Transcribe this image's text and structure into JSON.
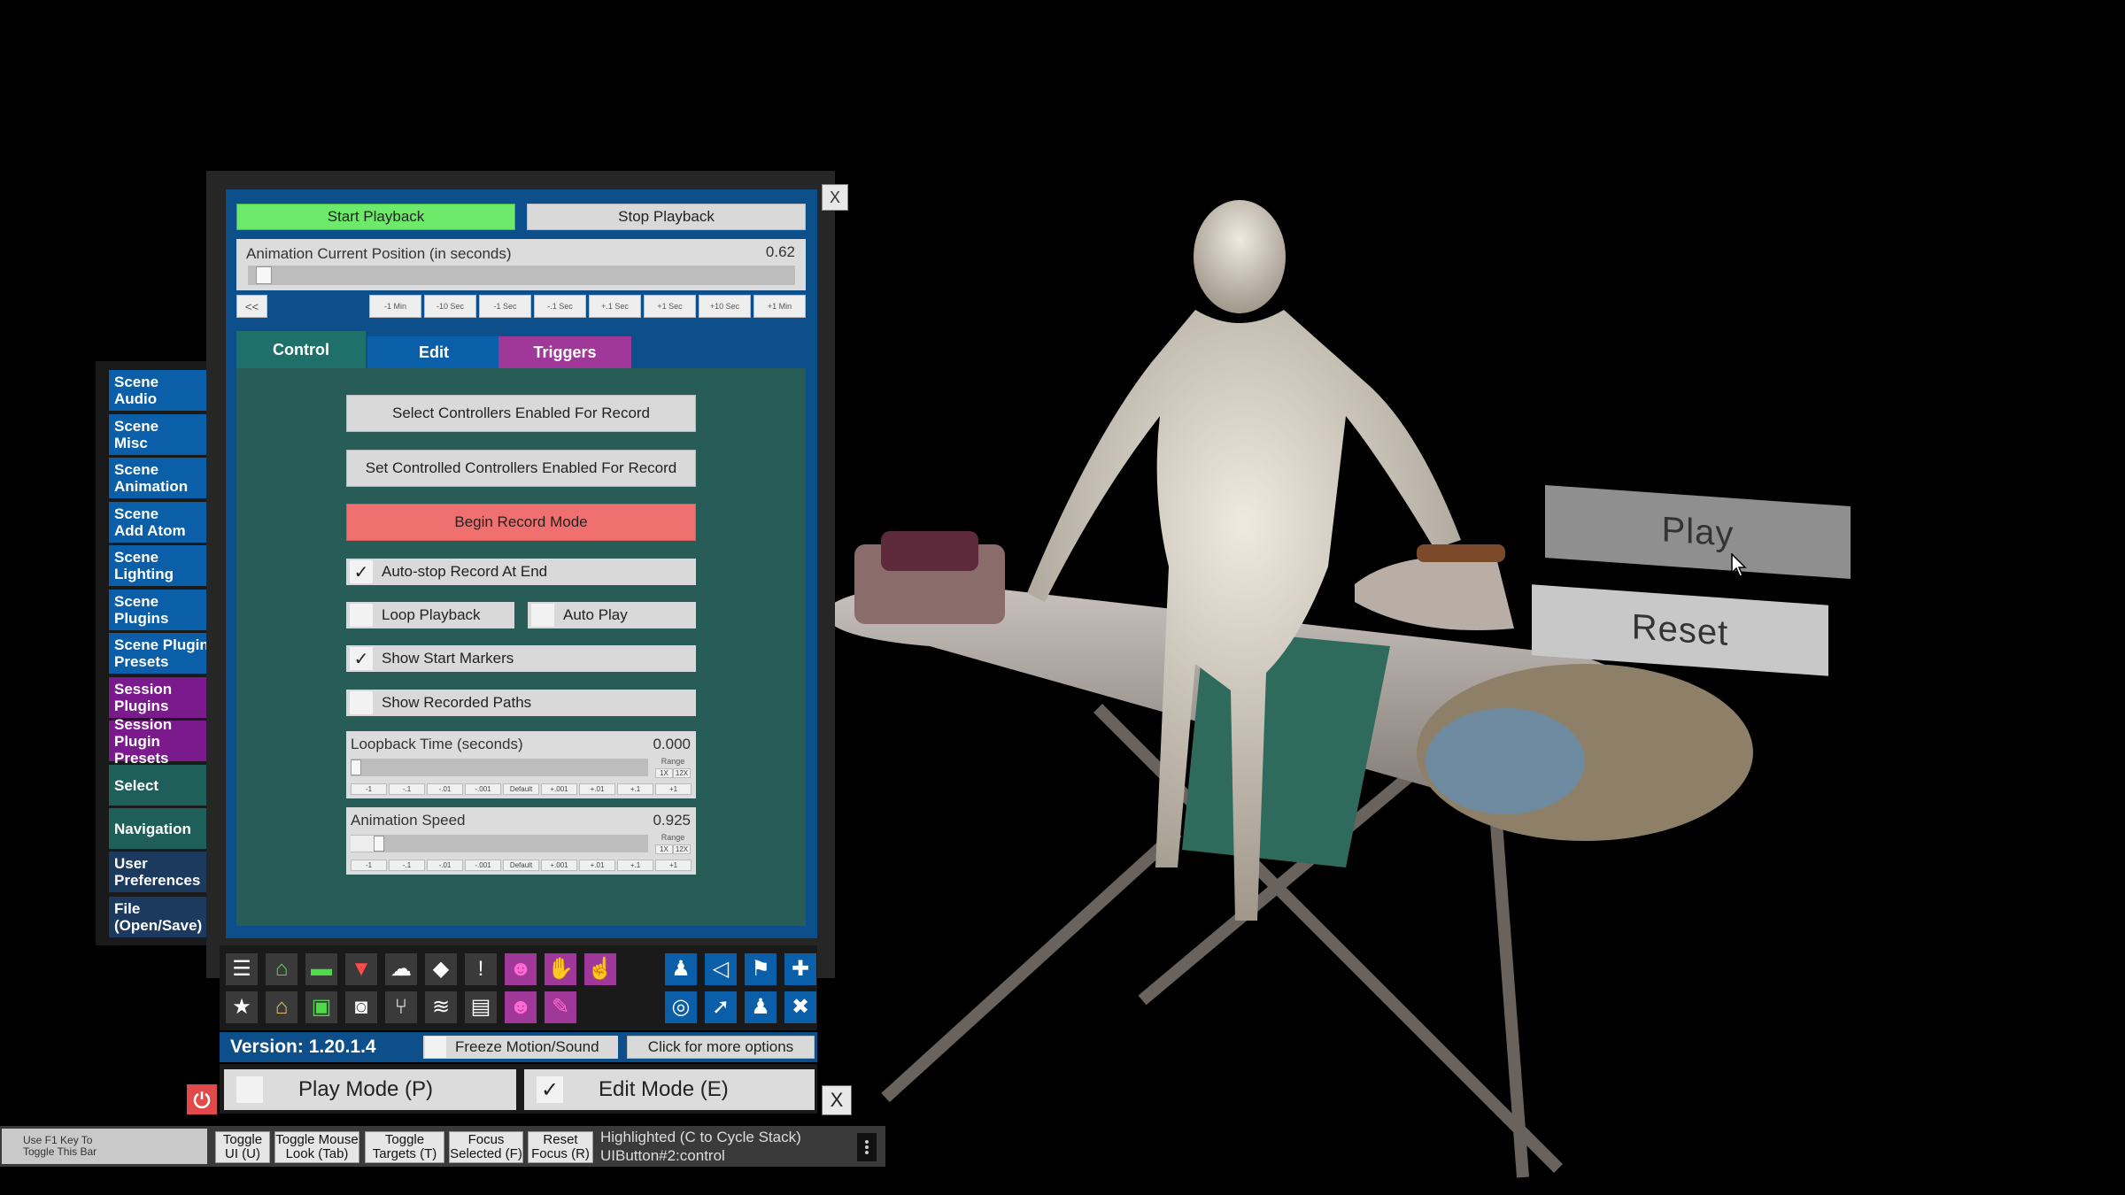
{
  "scene": {
    "play_label": "Play",
    "reset_label": "Reset"
  },
  "categories": [
    {
      "label": "Scene\nAudio",
      "color": "#0a5fa8"
    },
    {
      "label": "Scene\nMisc",
      "color": "#0a5fa8"
    },
    {
      "label": "Scene\nAnimation",
      "color": "#0a5fa8"
    },
    {
      "label": "Scene\nAdd Atom",
      "color": "#0a5fa8"
    },
    {
      "label": "Scene\nLighting",
      "color": "#0a5fa8"
    },
    {
      "label": "Scene\nPlugins",
      "color": "#0a5fa8"
    },
    {
      "label": "Scene Plugin\nPresets",
      "color": "#0a5fa8"
    },
    {
      "label": "Session\nPlugins",
      "color": "#7a1a8c"
    },
    {
      "label": "Session Plugin\nPresets",
      "color": "#7a1a8c"
    },
    {
      "label": "Select",
      "color": "#1f5f5a"
    },
    {
      "label": "Navigation",
      "color": "#1f5f5a"
    },
    {
      "label": "User\nPreferences",
      "color": "#1c3a5e"
    },
    {
      "label": "File\n(Open/Save)",
      "color": "#1c3a5e"
    }
  ],
  "panel": {
    "close_label": "X",
    "start_playback": "Start Playback",
    "stop_playback": "Stop Playback",
    "position_label": "Animation Current Position (in seconds)",
    "position_value": "0.62",
    "position_fraction": 0.01,
    "rewind_label": "<<",
    "step_buttons": [
      "-1 Min",
      "-10 Sec",
      "-1 Sec",
      "-.1 Sec",
      "+.1 Sec",
      "+1 Sec",
      "+10 Sec",
      "+1 Min"
    ],
    "tabs": [
      {
        "label": "Control",
        "color": "#1f6f6a"
      },
      {
        "label": "Edit",
        "color": "#0a5fa8"
      },
      {
        "label": "Triggers",
        "color": "#a0389a"
      }
    ],
    "select_controllers": "Select Controllers Enabled For Record",
    "set_controllers": "Set Controlled Controllers Enabled For Record",
    "begin_record": "Begin Record Mode",
    "auto_stop": {
      "label": "Auto-stop Record At End",
      "checked": true
    },
    "loop_playback": {
      "label": "Loop Playback",
      "checked": false
    },
    "auto_play": {
      "label": "Auto Play",
      "checked": false
    },
    "show_start_markers": {
      "label": "Show Start Markers",
      "checked": true
    },
    "show_recorded_paths": {
      "label": "Show Recorded Paths",
      "checked": false
    },
    "loopback": {
      "label": "Loopback Time (seconds)",
      "value": "0.000",
      "fraction": 0.0,
      "range_label": "Range",
      "range_buttons": [
        "1X",
        "12X"
      ],
      "steps": [
        "-1",
        "-.1",
        "-.01",
        "-.001",
        "Default",
        "+.001",
        "+.01",
        "+.1",
        "+1"
      ]
    },
    "speed": {
      "label": "Animation Speed",
      "value": "0.925",
      "fraction": 0.08,
      "range_label": "Range",
      "range_buttons": [
        "1X",
        "12X"
      ],
      "steps": [
        "-1",
        "-.1",
        "-.01",
        "-.001",
        "Default",
        "+.001",
        "+.01",
        "+.1",
        "+1"
      ]
    }
  },
  "toolbar": {
    "row1_left": [
      "menu-icon",
      "open-scene-icon",
      "folder-icon",
      "save-icon",
      "cloud-icon",
      "cube-icon",
      "alert-icon",
      "person-add-icon",
      "hand-icon",
      "pointer-hand-icon"
    ],
    "row2_left": [
      "star-icon",
      "load-look-icon",
      "folder-add-icon",
      "camera-icon",
      "branch-icon",
      "layers-icon",
      "document-icon",
      "person-settings-icon",
      "wrench-icon"
    ],
    "row1_right": [
      "person-icon",
      "unity-icon",
      "flag-icon",
      "plus-icon"
    ],
    "row2_right": [
      "target-icon",
      "cursor-icon",
      "people-icon",
      "tools-icon"
    ]
  },
  "status": {
    "version": "Version: 1.20.1.4",
    "freeze_label": "Freeze Motion/Sound",
    "more_options": "Click for more options",
    "play_mode": "Play Mode (P)",
    "edit_mode": "Edit Mode (E)",
    "close_label": "X"
  },
  "bottom_bar": {
    "hint": "Use F1 Key To\nToggle This Bar",
    "buttons": [
      "Toggle\nUI (U)",
      "Toggle Mouse\nLook (Tab)",
      "Toggle\nTargets (T)",
      "Focus\nSelected (F)",
      "Reset\nFocus (R)"
    ],
    "highlight_title": "Highlighted (C to Cycle Stack)",
    "highlight_value": "UIButton#2:control"
  },
  "colors": {
    "panel_blue": "#0d4f8b",
    "panel_teal": "#275c57",
    "start_green": "#6dea6a",
    "record_red": "#f07070"
  }
}
